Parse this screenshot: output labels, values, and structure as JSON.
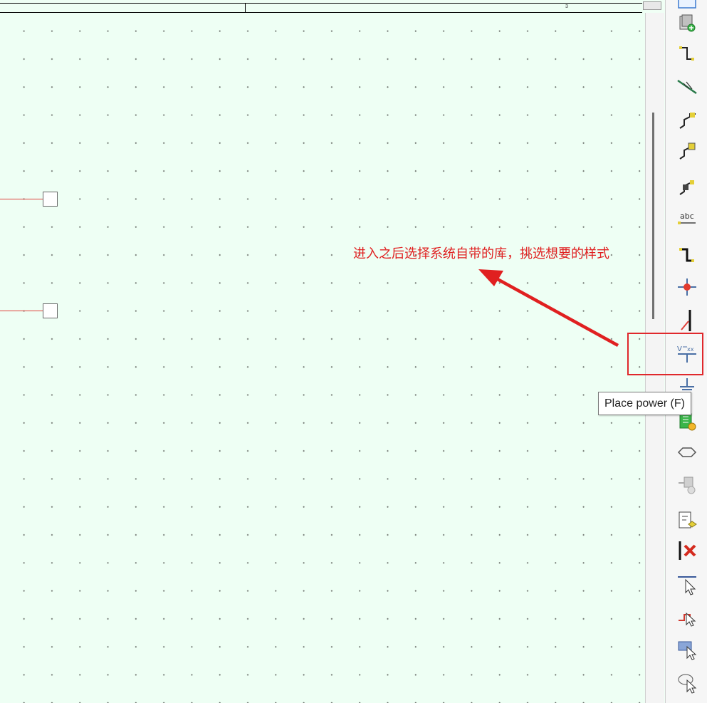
{
  "ruler": {
    "label": "3"
  },
  "annotation": {
    "text": "进入之后选择系统自带的库，挑选想要的样式"
  },
  "tooltip": {
    "text": "Place power (F)"
  },
  "colors": {
    "canvas": "#eefff4",
    "wire": "#e0403a",
    "annotation": "#e02020"
  },
  "toolbar": [
    {
      "icon": "select-arrow-icon"
    },
    {
      "icon": "place-part-icon"
    },
    {
      "icon": "place-wire-icon"
    },
    {
      "icon": "auto-wire-icon"
    },
    {
      "icon": "place-bus-icon"
    },
    {
      "icon": "place-bus-entry-icon"
    },
    {
      "icon": "place-net-group-icon"
    },
    {
      "icon": "place-net-alias-icon"
    },
    {
      "icon": "place-bus-wire-icon"
    },
    {
      "icon": "place-junction-icon"
    },
    {
      "icon": "place-no-connect-icon"
    },
    {
      "icon": "place-power-icon"
    },
    {
      "icon": "place-ground-icon"
    },
    {
      "icon": "place-hierarchical-block-icon"
    },
    {
      "icon": "place-port-icon"
    },
    {
      "icon": "place-pin-icon"
    },
    {
      "icon": "place-off-page-connector-icon"
    },
    {
      "icon": "delete-connector-icon"
    },
    {
      "icon": "select-line-icon"
    },
    {
      "icon": "select-polyline-icon"
    },
    {
      "icon": "select-rectangle-icon"
    },
    {
      "icon": "select-ellipse-icon"
    }
  ]
}
